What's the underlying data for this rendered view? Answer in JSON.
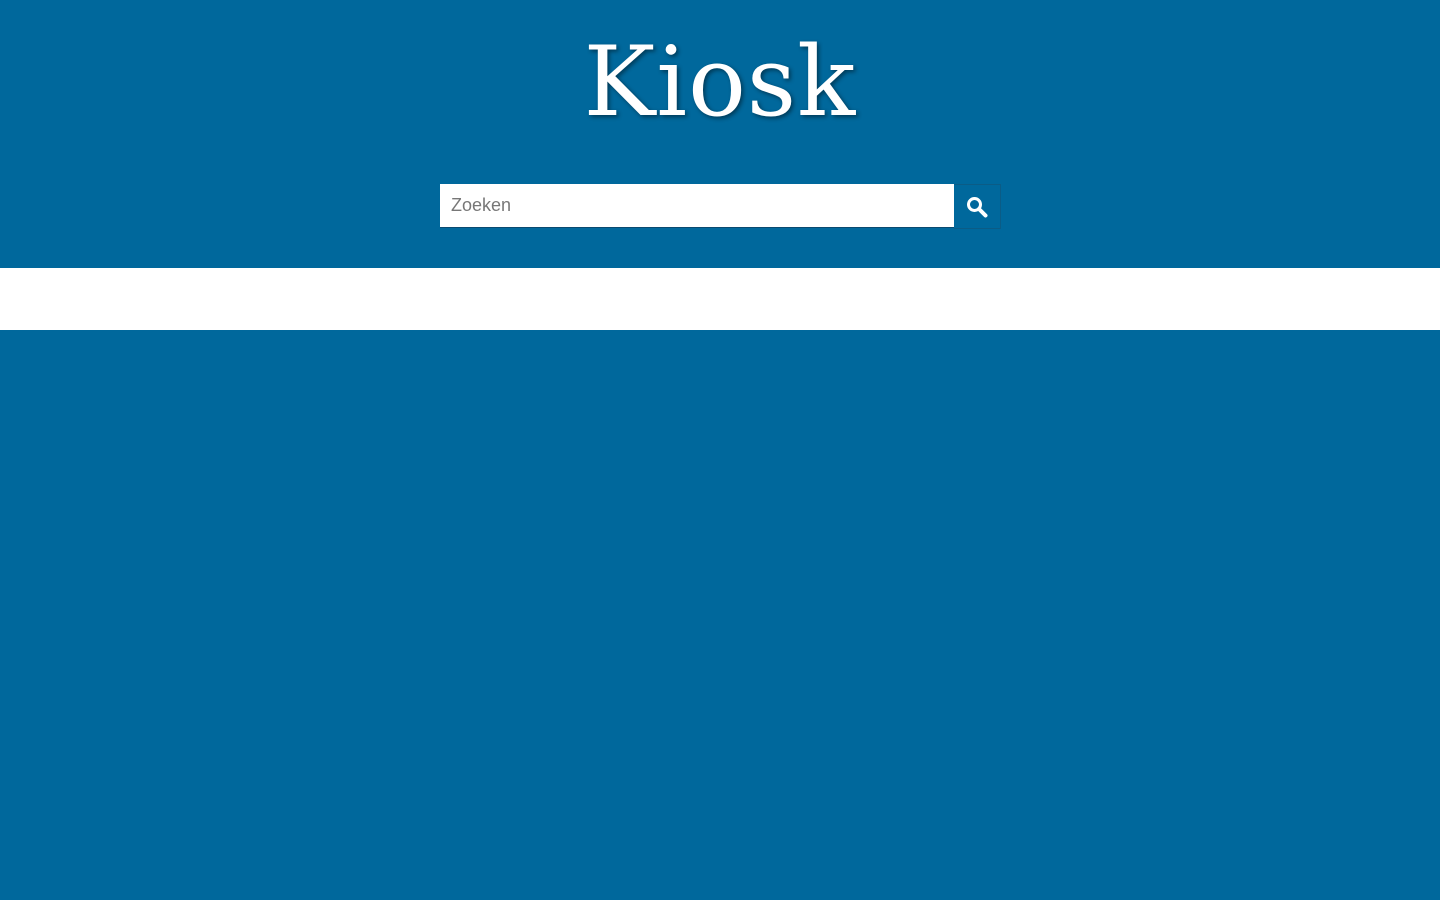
{
  "header": {
    "logo_text": "Kiosk"
  },
  "search": {
    "placeholder": "Zoeken",
    "value": "",
    "button_icon": "search-icon"
  },
  "colors": {
    "brand_blue": "#00689c",
    "band_white": "#ffffff"
  }
}
